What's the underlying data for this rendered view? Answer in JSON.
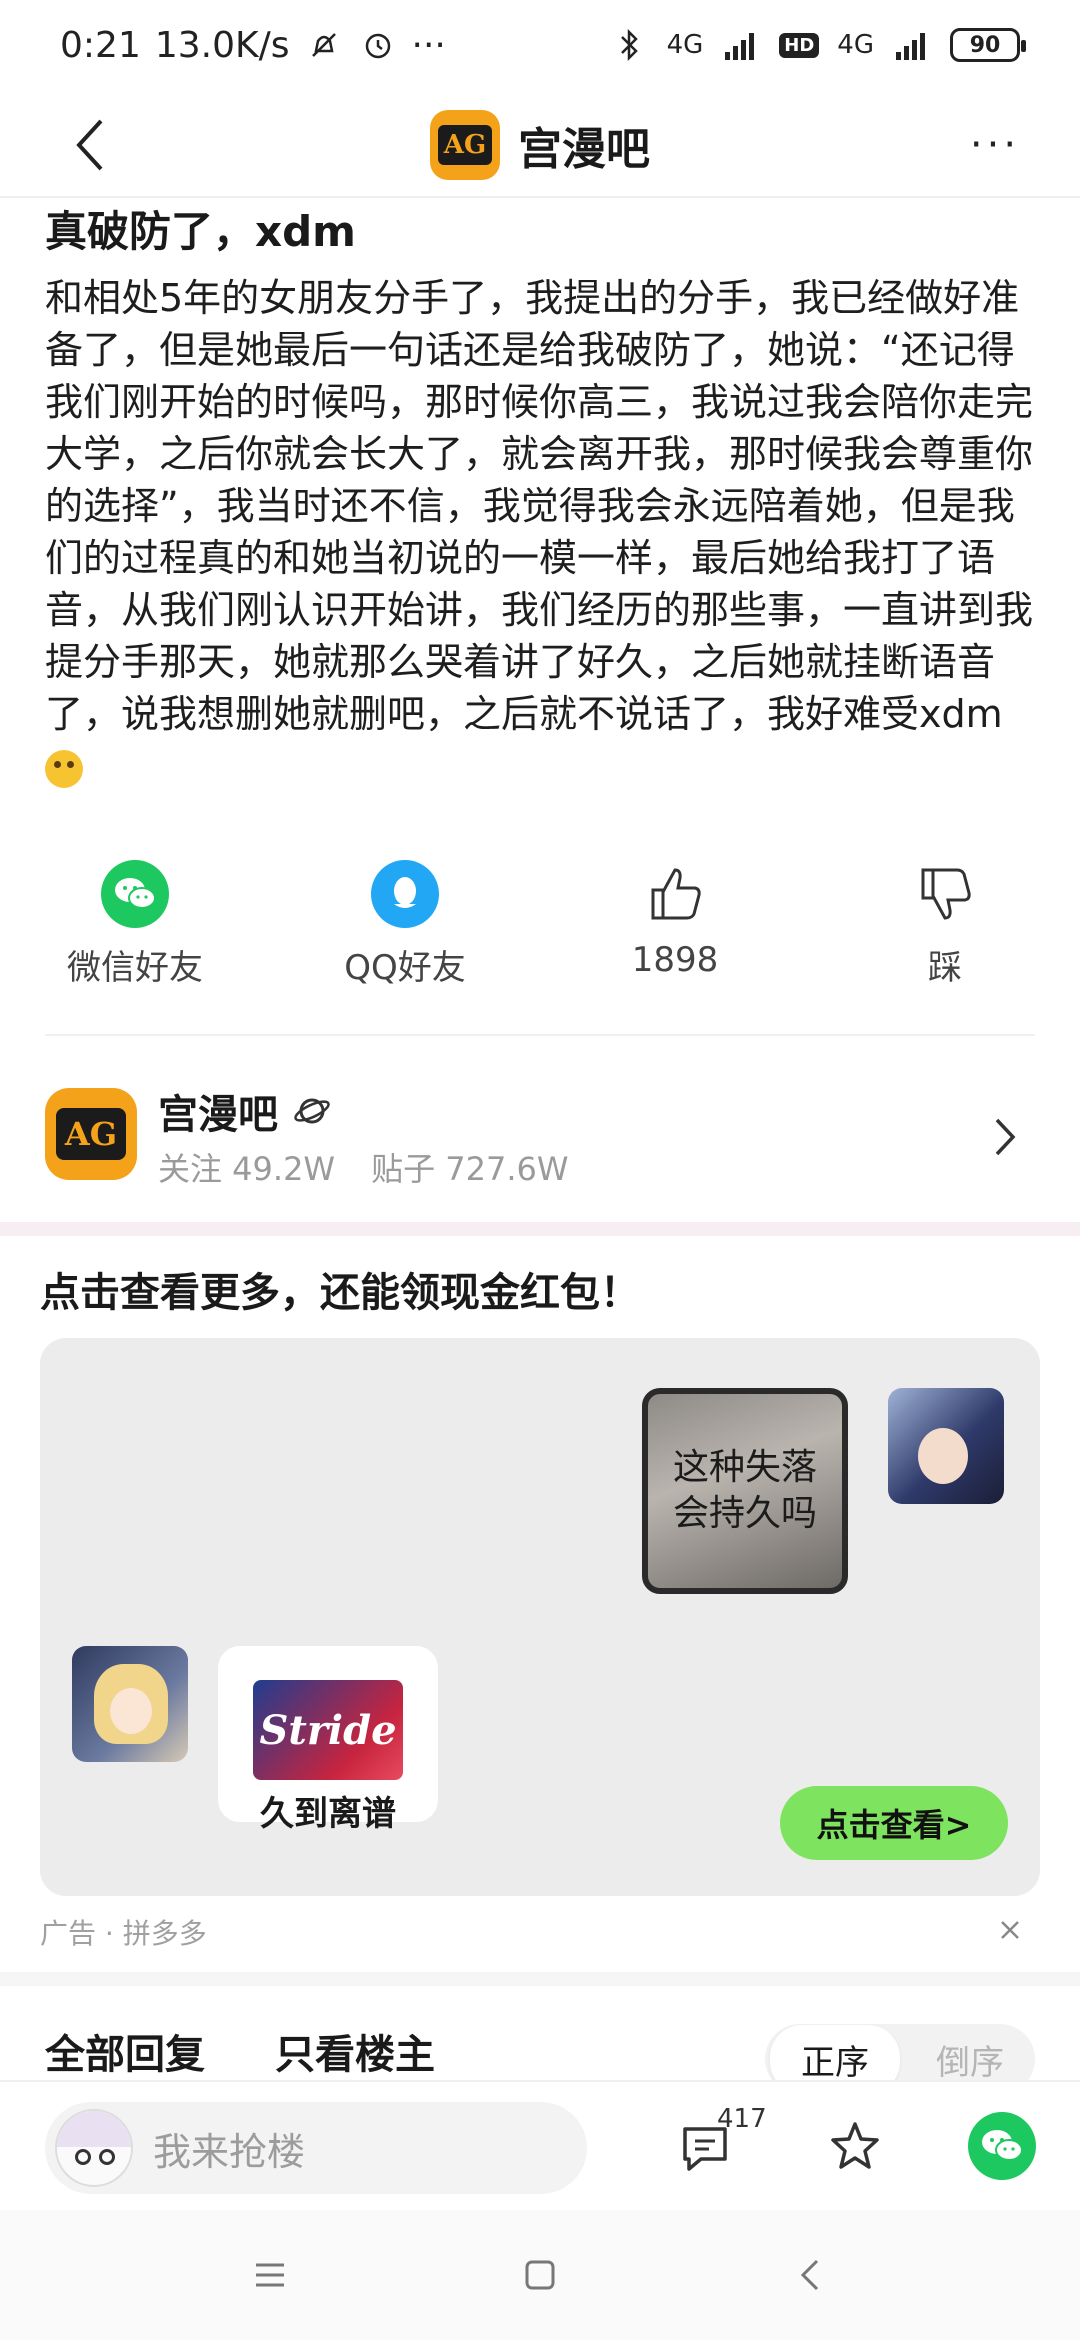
{
  "status_bar": {
    "time": "0:21",
    "speed": "13.0K/s",
    "more": "···",
    "network_1": "4G",
    "hd": "HD",
    "network_2": "4G",
    "battery": "90"
  },
  "header": {
    "title": "宫漫吧",
    "logo_text": "AG",
    "more_label": "···"
  },
  "post": {
    "title": "真破防了，xdm",
    "body": "和相处5年的女朋友分手了，我提出的分手，我已经做好准备了，但是她最后一句话还是给我破防了，她说：“还记得我们刚开始的时候吗，那时候你高三，我说过我会陪你走完大学，之后你就会长大了，就会离开我，那时候我会尊重你的选择”，我当时还不信，我觉得我会永远陪着她，但是我们的过程真的和她当初说的一模一样，最后她给我打了语音，从我们刚认识开始讲，我们经历的那些事，一直讲到我提分手那天，她就那么哭着讲了好久，之后她就挂断语音了，说我想删她就删吧，之后就不说话了，我好难受xdm"
  },
  "share": {
    "wechat": "微信好友",
    "qq": "QQ好友",
    "likes": "1898",
    "dislike": "踩"
  },
  "forum": {
    "name": "宫漫吧",
    "logo_text": "AG",
    "followers": "关注 49.2W",
    "posts": "贴子 727.6W"
  },
  "ad": {
    "title": "点击查看更多，还能领现金红包！",
    "wall_text_line1": "这种失落",
    "wall_text_line2": "会持久吗",
    "gum_brand": "Stride",
    "gum_caption": "久到离谱",
    "cta": "点击查看>",
    "source": "广告 · 拼多多"
  },
  "replies": {
    "tab_all": "全部回复",
    "tab_op": "只看楼主",
    "sort_asc": "正序",
    "sort_desc": "倒序"
  },
  "bottom_bar": {
    "input_placeholder": "我来抢楼",
    "comment_count": "417"
  },
  "colors": {
    "brand_orange": "#f5a21b",
    "wechat_green": "#1ec860",
    "qq_blue": "#22a7f5",
    "cta_green": "#7ee35e"
  }
}
